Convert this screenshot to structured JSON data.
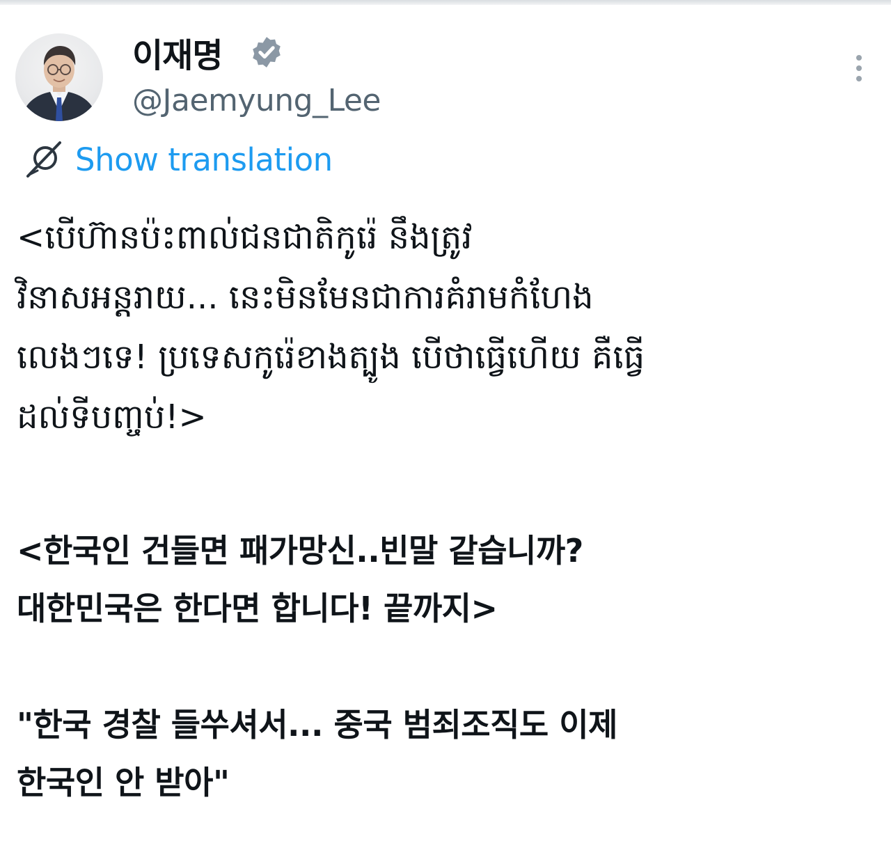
{
  "tweet": {
    "author": {
      "display_name": "이재명",
      "handle": "@Jaemyung_Lee",
      "verified": true,
      "avatar_icon": "profile-photo"
    },
    "more_icon": "more-vertical-icon",
    "translate": {
      "icon": "translate-globe-icon",
      "label": "Show translation"
    },
    "paragraphs": [
      "<បើហ៊ានប៉ះពាល់ជនជាតិកូរ៉េ នឹងត្រូវ\nវិនាសអន្តរាយ... នេះមិនមែនជាការគំរាមកំហែង\nលេងៗទេ! ប្រទេសកូរ៉េខាងត្បូង បើថាធ្វើហើយ គឺធ្វើ\nដល់ទីបញ្ចប់!>",
      "<한국인 건들면 패가망신..빈말 같습니까?\n대한민국은 한다면 합니다! 끝까지>",
      "\"한국 경찰 들쑤셔서... 중국 범죄조직도 이제\n한국인 안 받아\""
    ]
  },
  "colors": {
    "link": "#1d9bf0",
    "secondary_text": "#536471",
    "primary_text": "#0f1419",
    "verified_badge": "#8b98a5"
  }
}
